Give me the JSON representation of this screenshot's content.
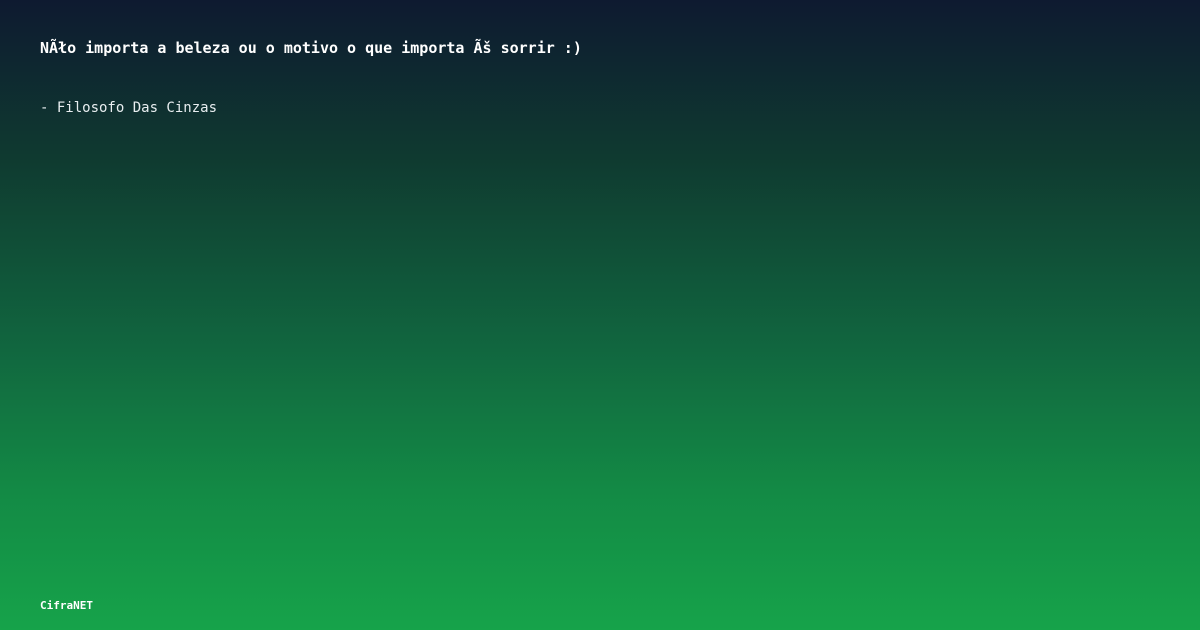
{
  "card": {
    "quote": "NÃło importa a beleza ou o motivo o que importa Ãš sorrir :)",
    "author": "- Filosofo Das Cinzas",
    "brand": "CifraNET"
  },
  "colors": {
    "gradient_top": "#0e1a30",
    "gradient_bottom": "#16a34a",
    "text": "#ffffff"
  }
}
